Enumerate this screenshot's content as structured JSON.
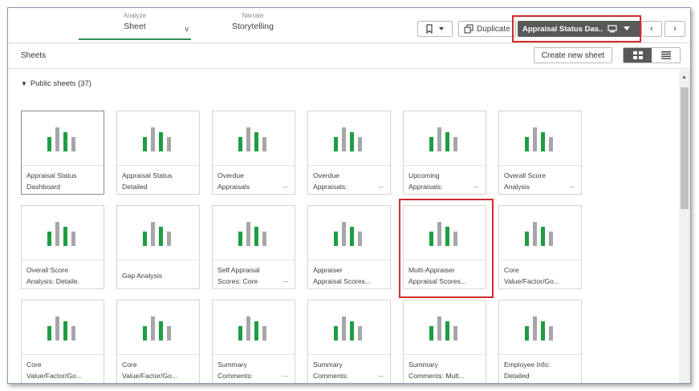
{
  "toolbar": {
    "analyze_small": "Analyze",
    "analyze_big": "Sheet",
    "narrate_small": "Narrate",
    "narrate_big": "Storytelling",
    "duplicate_label": "Duplicate",
    "current_sheet": "Appraisal Status Das...",
    "chevron": "∨",
    "prev": "‹",
    "next": "›"
  },
  "sheets_panel": {
    "title": "Sheets",
    "create_label": "Create new sheet",
    "section_label": "Public sheets (37)"
  },
  "colors": {
    "accent_green": "#2f8f54",
    "bar_green": "#1f9d43",
    "bar_gray": "#a6a6a6",
    "highlight_red": "#d62b2b",
    "dark_button": "#595959"
  },
  "cards": [
    {
      "line1": "Appraisal Status",
      "line2": "Dashboard",
      "dots": ""
    },
    {
      "line1": "Appraisal Status",
      "line2": "Detailed",
      "dots": ""
    },
    {
      "line1": "Overdue",
      "line2": "Appraisals",
      "dots": "..."
    },
    {
      "line1": "Overdue",
      "line2": "Appraisals:",
      "dots": "..."
    },
    {
      "line1": "Upcoming",
      "line2": "Appraisals:",
      "dots": "..."
    },
    {
      "line1": "Overall Score",
      "line2": "Analysis",
      "dots": "..."
    },
    {
      "line1": "Overall Score",
      "line2": "Analysis: Detaile.",
      "dots": ""
    },
    {
      "line1": "Gap Analysis",
      "line2": "",
      "dots": ""
    },
    {
      "line1": "Self Appraisal",
      "line2": "Scores: Core",
      "dots": "..."
    },
    {
      "line1": "Appraiser",
      "line2": "Appraisal Scores...",
      "dots": ""
    },
    {
      "line1": "Multi-Appraiser",
      "line2": "Appraisal Scores...",
      "dots": ""
    },
    {
      "line1": "Core",
      "line2": "Value/Factor/Go...",
      "dots": ""
    },
    {
      "line1": "Core",
      "line2": "Value/Factor/Go...",
      "dots": ""
    },
    {
      "line1": "Core",
      "line2": "Value/Factor/Go...",
      "dots": ""
    },
    {
      "line1": "Summary",
      "line2": "Comments:",
      "dots": "..."
    },
    {
      "line1": "Summary",
      "line2": "Comments:",
      "dots": "..."
    },
    {
      "line1": "Summary",
      "line2": "Comments: Mult...",
      "dots": ""
    },
    {
      "line1": "Employee Info:",
      "line2": "Detailed",
      "dots": ""
    }
  ]
}
